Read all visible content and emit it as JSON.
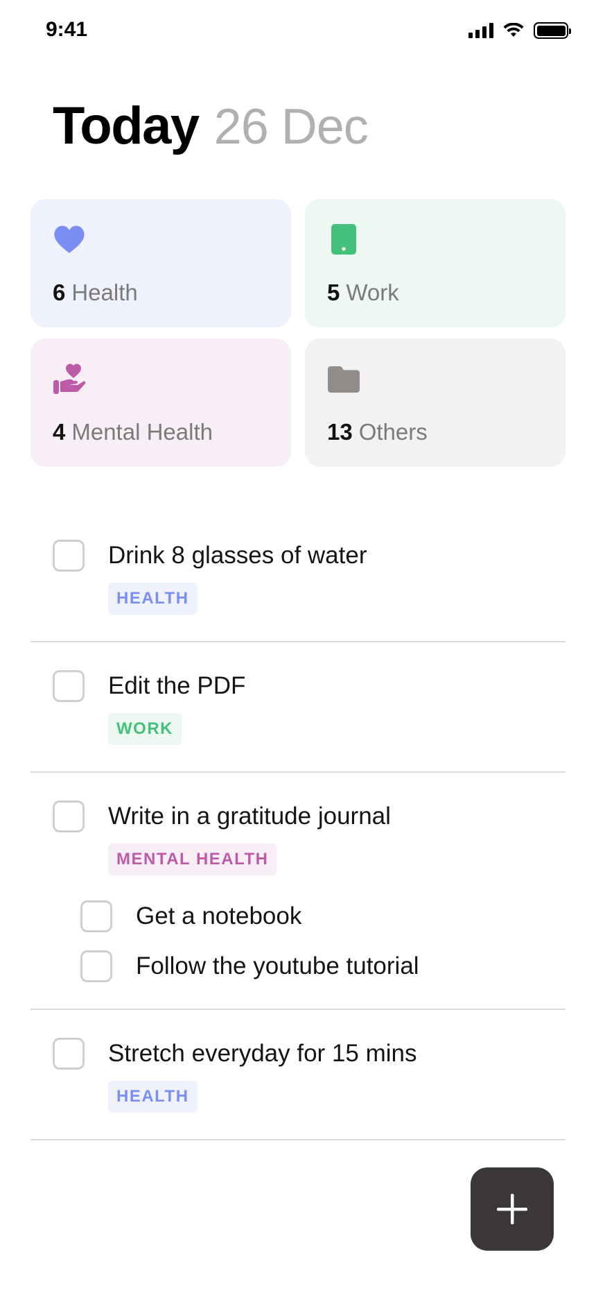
{
  "status_bar": {
    "time": "9:41"
  },
  "header": {
    "title": "Today",
    "date": "26 Dec"
  },
  "categories": [
    {
      "count": "6",
      "label": "Health",
      "icon": "heart-icon",
      "bg": "#eff2fd",
      "color": "#7b8ff3"
    },
    {
      "count": "5",
      "label": "Work",
      "icon": "tablet-icon",
      "bg": "#ecf8f1",
      "color": "#44c27c"
    },
    {
      "count": "4",
      "label": "Mental Health",
      "icon": "heart-in-hand-icon",
      "bg": "#f8eef5",
      "color": "#bd5ba8"
    },
    {
      "count": "13",
      "label": "Others",
      "icon": "folder-icon",
      "bg": "#f2f2f2",
      "color": "#928c8a"
    }
  ],
  "tasks": [
    {
      "title": "Drink 8 glasses of water",
      "tag": "HEALTH",
      "tag_color": "#7b8ff3",
      "tag_bg": "#eff2fd"
    },
    {
      "title": "Edit the PDF",
      "tag": "WORK",
      "tag_color": "#44c27c",
      "tag_bg": "#ecf8f1"
    },
    {
      "title": "Write in a gratitude journal",
      "tag": "MENTAL HEALTH",
      "tag_color": "#bd5ba8",
      "tag_bg": "#f8eef5",
      "subtasks": [
        {
          "title": "Get a notebook"
        },
        {
          "title": "Follow the youtube tutorial"
        }
      ]
    },
    {
      "title": "Stretch everyday for 15 mins",
      "tag": "HEALTH",
      "tag_color": "#7b8ff3",
      "tag_bg": "#eff2fd"
    }
  ],
  "fab": {
    "icon": "plus-icon",
    "bg": "#3b3736"
  }
}
